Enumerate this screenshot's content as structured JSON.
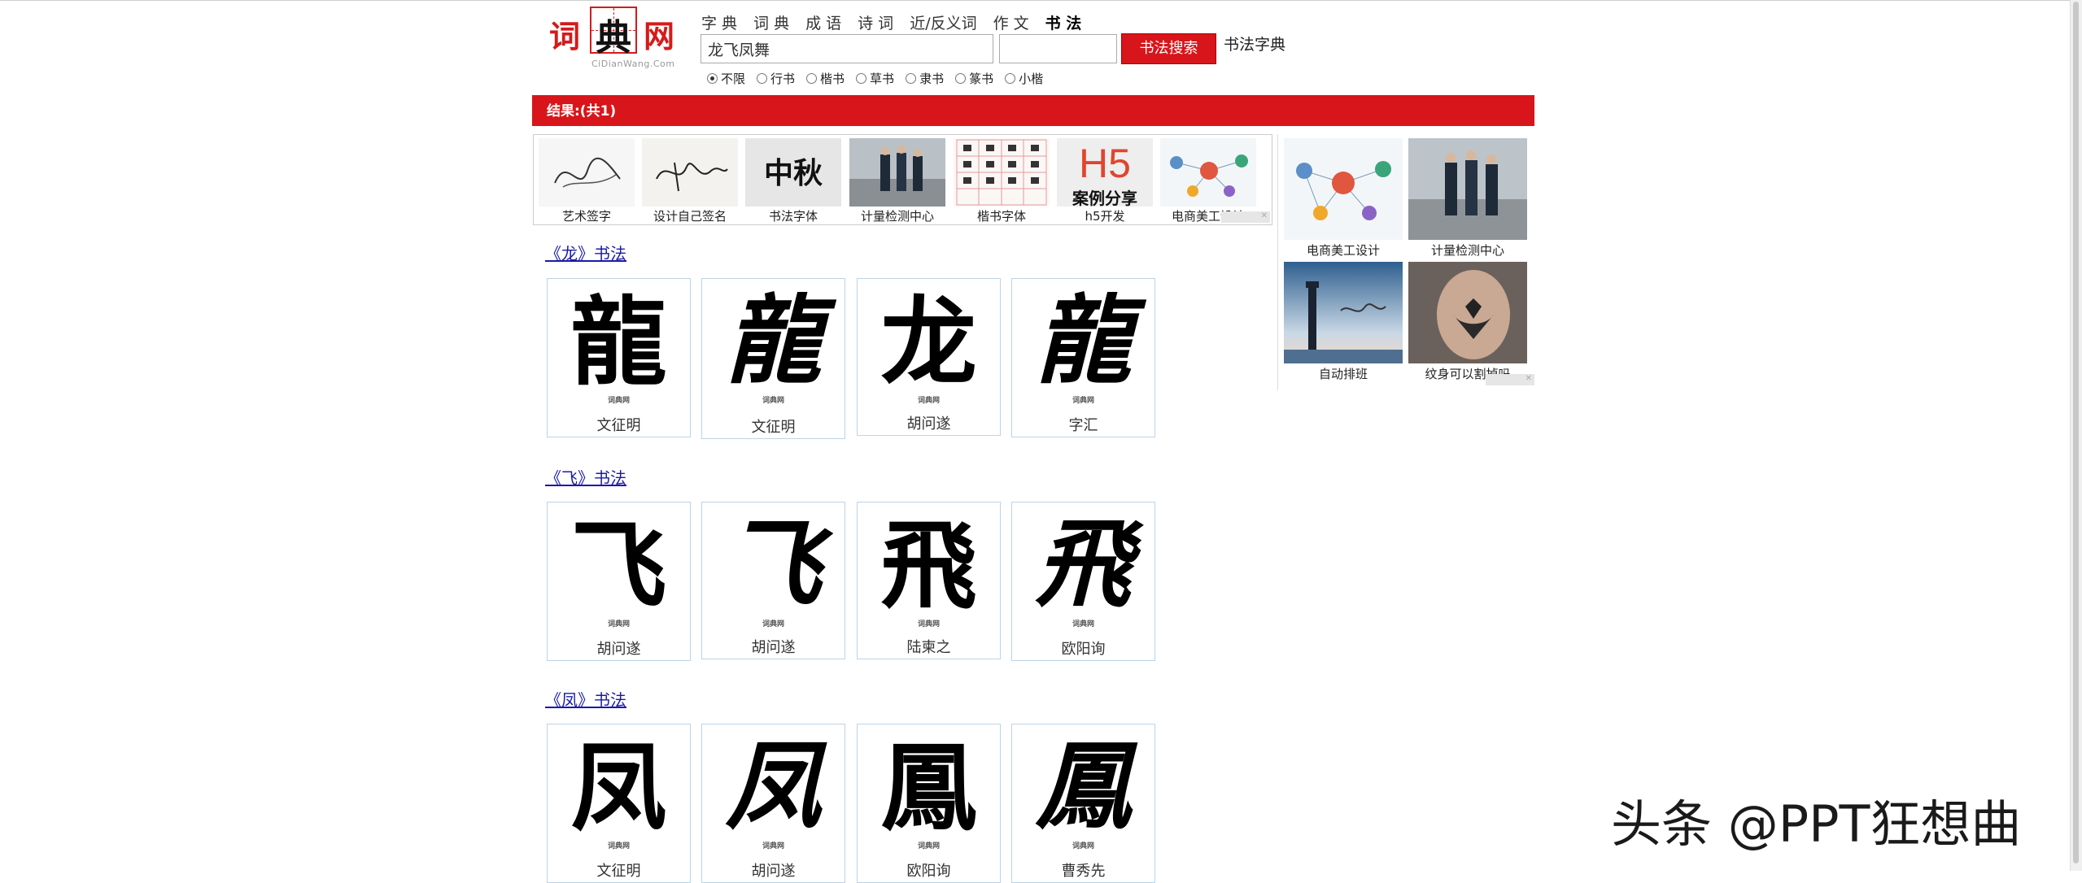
{
  "logo": {
    "chars": [
      "词",
      "典",
      "网"
    ],
    "sub": "CiDianWang.Com"
  },
  "nav": [
    "字 典",
    "词 典",
    "成 语",
    "诗 词",
    "近/反义词",
    "作 文",
    "书 法"
  ],
  "search": {
    "query": "龙飞凤舞",
    "button": "书法搜索",
    "link": "书法字典"
  },
  "styles": [
    {
      "label": "不限",
      "checked": true
    },
    {
      "label": "行书",
      "checked": false
    },
    {
      "label": "楷书",
      "checked": false
    },
    {
      "label": "草书",
      "checked": false
    },
    {
      "label": "隶书",
      "checked": false
    },
    {
      "label": "篆书",
      "checked": false
    },
    {
      "label": "小楷",
      "checked": false
    }
  ],
  "result_label": "结果:(共1)",
  "ads_top": [
    "艺术签字",
    "设计自己签名",
    "书法字体",
    "计量检测中心",
    "楷书字体",
    "h5开发",
    "电商美工设计"
  ],
  "ads_right": [
    "电商美工设计",
    "计量检测中心",
    "自动排班",
    "纹身可以割掉吗"
  ],
  "ad_images": {
    "h5_big": "H5",
    "h5_small": "案例分享",
    "calligraphy": "中秋"
  },
  "sections": [
    {
      "title": "《龙》书法",
      "glyph": "龙",
      "items": [
        {
          "wm": "词典网",
          "author": "文征明"
        },
        {
          "wm": "词典网",
          "author": "文征明"
        },
        {
          "wm": "词典网",
          "author": "胡问遂"
        },
        {
          "wm": "词典网",
          "author": "字汇"
        }
      ]
    },
    {
      "title": "《飞》书法",
      "glyph": "飞",
      "items": [
        {
          "wm": "词典网",
          "author": "胡问遂"
        },
        {
          "wm": "词典网",
          "author": "胡问遂"
        },
        {
          "wm": "词典网",
          "author": "陆柬之"
        },
        {
          "wm": "词典网",
          "author": "欧阳询"
        }
      ]
    },
    {
      "title": "《凤》书法",
      "glyph": "凤",
      "items": [
        {
          "wm": "词典网",
          "author": "文征明"
        },
        {
          "wm": "词典网",
          "author": "胡问遂"
        },
        {
          "wm": "词典网",
          "author": "欧阳询"
        },
        {
          "wm": "词典网",
          "author": "曹秀先"
        }
      ]
    }
  ],
  "card_glyphs": [
    [
      "龍",
      "龍",
      "龙",
      "龍"
    ],
    [
      "飞",
      "飞",
      "飛",
      "飛"
    ],
    [
      "凤",
      "凤",
      "鳳",
      "鳳"
    ]
  ],
  "watermark": "头条 @PPT狂想曲"
}
